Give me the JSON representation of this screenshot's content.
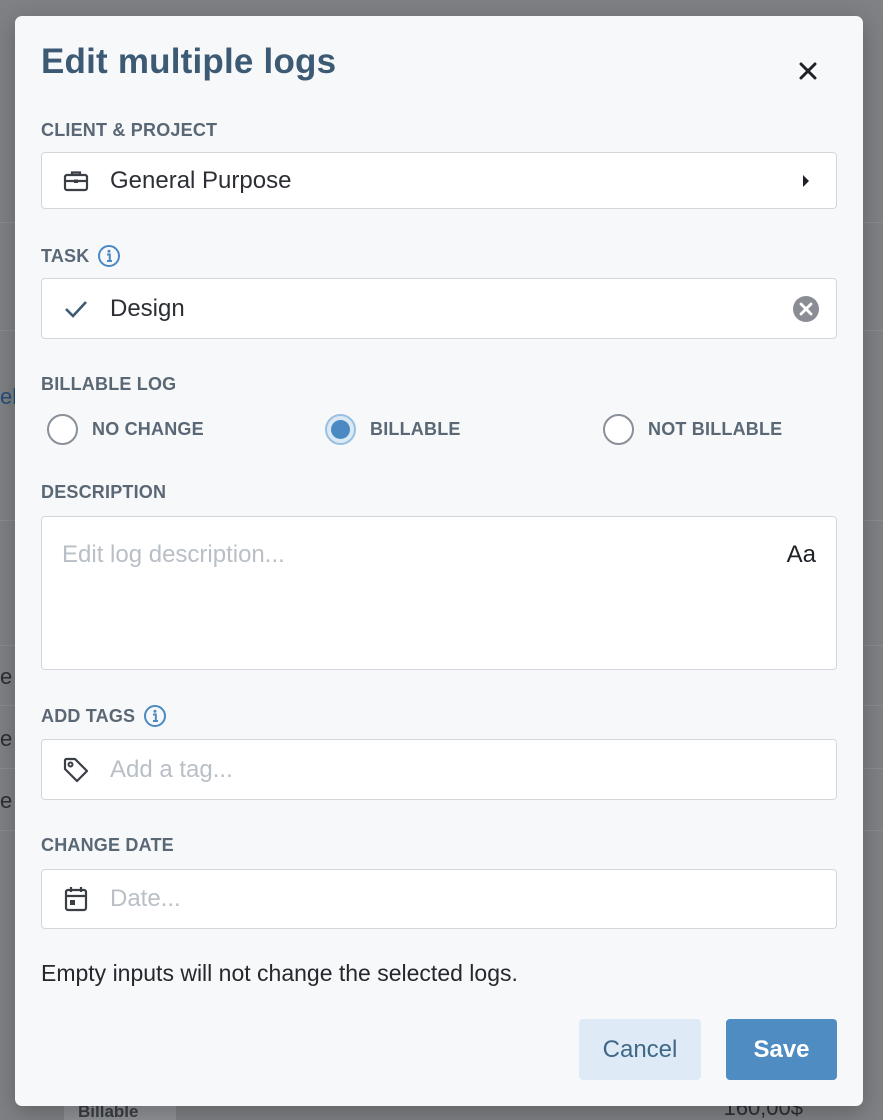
{
  "background": {
    "fragments": [
      "el",
      "e",
      "e",
      "e"
    ],
    "badge": "Billable",
    "amount": "160,00$"
  },
  "modal": {
    "title": "Edit multiple logs",
    "client_project": {
      "label": "CLIENT & PROJECT",
      "value": "General Purpose"
    },
    "task": {
      "label": "TASK",
      "value": "Design"
    },
    "billable": {
      "label": "BILLABLE LOG",
      "options": [
        "NO CHANGE",
        "BILLABLE",
        "NOT BILLABLE"
      ],
      "selected": "BILLABLE"
    },
    "description": {
      "label": "DESCRIPTION",
      "placeholder": "Edit log description...",
      "format_toggle": "Aa"
    },
    "tags": {
      "label": "ADD TAGS",
      "placeholder": "Add a tag..."
    },
    "date": {
      "label": "CHANGE DATE",
      "placeholder": "Date..."
    },
    "note": "Empty inputs will not change the selected logs.",
    "cancel_label": "Cancel",
    "save_label": "Save"
  },
  "colors": {
    "accent": "#4f8cc2",
    "title": "#3c5a73",
    "label": "#5a6775"
  }
}
